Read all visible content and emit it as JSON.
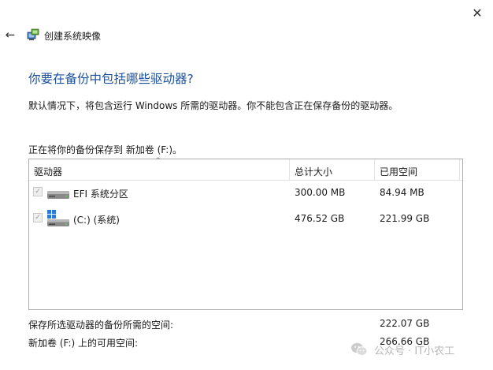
{
  "window": {
    "title": "创建系统映像",
    "close_glyph": "✕",
    "back_glyph": "←",
    "app_icon": "system-image-backup-icon"
  },
  "main": {
    "heading": "你要在备份中包括哪些驱动器?",
    "description": "默认情况下，将包含运行 Windows 所需的驱动器。你不能包含正在保存备份的驱动器。",
    "save_to": "正在将你的备份保存到 新加卷 (F:)。"
  },
  "table": {
    "columns": [
      "驱动器",
      "总计大小",
      "已用空间"
    ],
    "sort_indicator": "^",
    "rows": [
      {
        "checked": true,
        "disabled": true,
        "icon": "drive-icon",
        "name": "EFI 系统分区",
        "total": "300.00 MB",
        "used": "84.94 MB"
      },
      {
        "checked": true,
        "disabled": true,
        "icon": "windows-drive-icon",
        "name": "(C:) (系统)",
        "total": "476.52 GB",
        "used": "221.99 GB"
      }
    ]
  },
  "footer": {
    "required_label": "保存所选驱动器的备份所需的空间:",
    "required_value": "222.07 GB",
    "available_label": "新加卷 (F:) 上的可用空间:",
    "available_value": "266.66 GB"
  },
  "watermark": {
    "icon": "wechat-icon",
    "text": "公众号 · IT小农工"
  }
}
